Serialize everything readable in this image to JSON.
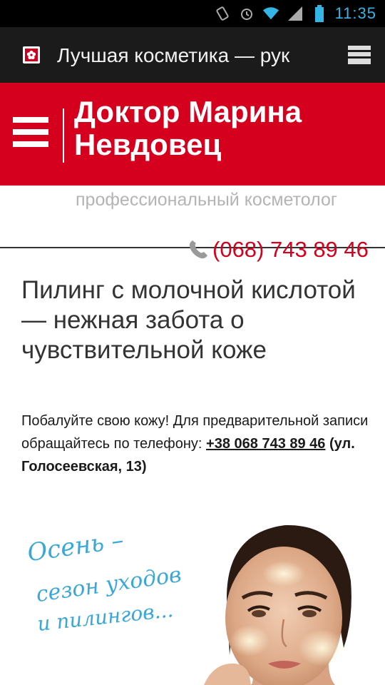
{
  "status_bar": {
    "time": "11:35",
    "icons": [
      "rotate-icon",
      "alarm-icon",
      "wifi-icon",
      "signal-icon",
      "battery-icon"
    ],
    "accent_color": "#33b5e5"
  },
  "browser": {
    "page_title": "Лучшая косметика — рук",
    "favicon": "flower-icon",
    "tabs_icon": "tabs-icon"
  },
  "header": {
    "site_name": "Доктор Марина Невдовец",
    "brand_color": "#d4001d",
    "menu_icon": "hamburger-menu-icon"
  },
  "tagline": "профессиональный косметолог",
  "phone": {
    "number": "(068) 743 89 46",
    "icon": "phone-icon"
  },
  "article": {
    "title": "Пилинг с молочной кислотой — нежная забота о чувствительной коже",
    "intro_text": "Побалуйте свою кожу! Для предварительной записи обращайтесь по телефону: ",
    "intro_phone": "+38 068 743 89 46",
    "intro_address": " (ул. Голосеевская, 13)"
  },
  "banner": {
    "script_line_1": "Осень –",
    "script_line_2": "сезон уходов",
    "script_line_3": "и пилингов..."
  }
}
